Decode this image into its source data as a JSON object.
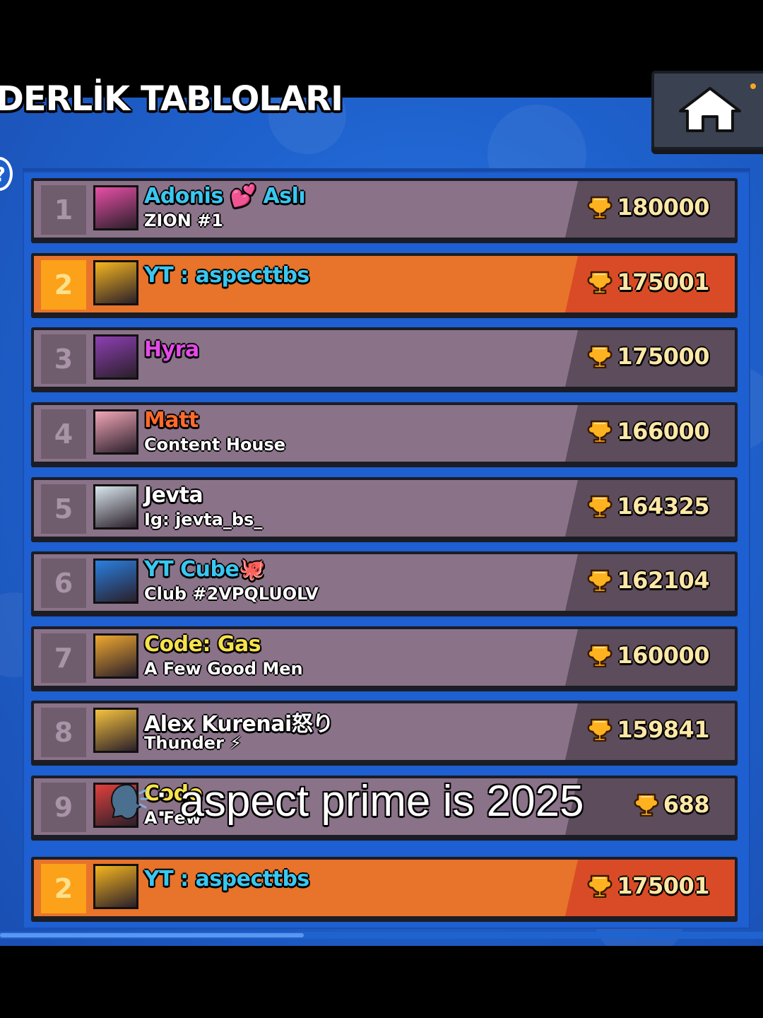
{
  "header": {
    "title": "DERLİK TABLOLARI",
    "home_icon": "home-icon",
    "info_icon": "info-icon"
  },
  "colors": {
    "background": "#1f63cf",
    "row_default": "#8a7288",
    "row_highlight": "#e8732a",
    "score_default": "#5c4c5c",
    "score_highlight": "#d94b26",
    "trophy": "#ffb21f"
  },
  "leaderboard": {
    "rows": [
      {
        "rank": "1",
        "name": "Adonis 💕 Aslı",
        "club": "ZION #1",
        "trophies": "180000",
        "name_color": "#39c7f0",
        "avatar_color": "#e84fa6",
        "highlight": false
      },
      {
        "rank": "2",
        "name": "YT : aspecttbs",
        "club": "",
        "trophies": "175001",
        "name_color": "#39c7f0",
        "avatar_color": "#f5b51f",
        "highlight": true
      },
      {
        "rank": "3",
        "name": "Hyra",
        "club": "",
        "trophies": "175000",
        "name_color": "#e24be6",
        "avatar_color": "#8e3fb3",
        "highlight": false
      },
      {
        "rank": "4",
        "name": "Matt",
        "club": "Content House",
        "trophies": "166000",
        "name_color": "#ff6a2a",
        "avatar_color": "#f2a6b8",
        "highlight": false
      },
      {
        "rank": "5",
        "name": "Jevta",
        "club": "Ig: jevta_bs_",
        "trophies": "164325",
        "name_color": "#ffffff",
        "avatar_color": "#d9e6ec",
        "highlight": false
      },
      {
        "rank": "6",
        "name": "YT Cube🐙",
        "club": "Club #2VPQLUOLV",
        "trophies": "162104",
        "name_color": "#39c7f0",
        "avatar_color": "#2a7fe0",
        "highlight": false
      },
      {
        "rank": "7",
        "name": "Code: Gas",
        "club": "A Few Good Men",
        "trophies": "160000",
        "name_color": "#f7e24a",
        "avatar_color": "#f0a830",
        "highlight": false
      },
      {
        "rank": "8",
        "name": "Alex Kurenai怒り",
        "club": "Thunder ⚡",
        "trophies": "159841",
        "name_color": "#ffffff",
        "avatar_color": "#f6c23e",
        "highlight": false
      },
      {
        "rank": "9",
        "name": "Code",
        "club": "A Few",
        "trophies": "688",
        "name_color": "#f7e24a",
        "avatar_color": "#e0403c",
        "highlight": false
      }
    ],
    "self_row": {
      "rank": "2",
      "name": "YT : aspecttbs",
      "club": "",
      "trophies": "175001",
      "name_color": "#39c7f0",
      "avatar_color": "#f5b51f",
      "highlight": true
    }
  },
  "caption": {
    "icon": "speaking-head-icon",
    "text": ": aspect prime is 2025"
  }
}
